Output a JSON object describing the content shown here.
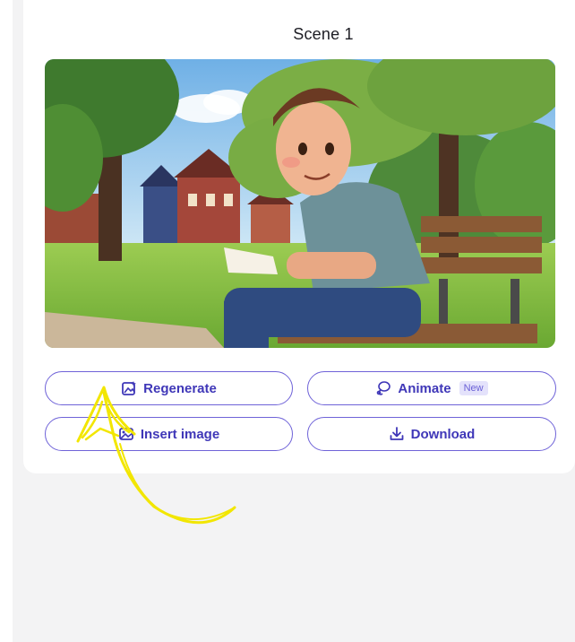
{
  "scene": {
    "title": "Scene 1",
    "image_alt": "cartoon man sitting on park bench reading a note"
  },
  "buttons": {
    "regenerate": {
      "label": "Regenerate",
      "icon": "image-sparkle-icon"
    },
    "animate": {
      "label": "Animate",
      "icon": "lasso-icon",
      "badge": "New"
    },
    "insert_image": {
      "label": "Insert image",
      "icon": "image-insert-icon"
    },
    "download": {
      "label": "Download",
      "icon": "download-icon"
    }
  },
  "colors": {
    "accent": "#3f37b8",
    "border": "#6f63d8",
    "badge_bg": "#e4e2fb",
    "annotation": "#f2e600"
  }
}
